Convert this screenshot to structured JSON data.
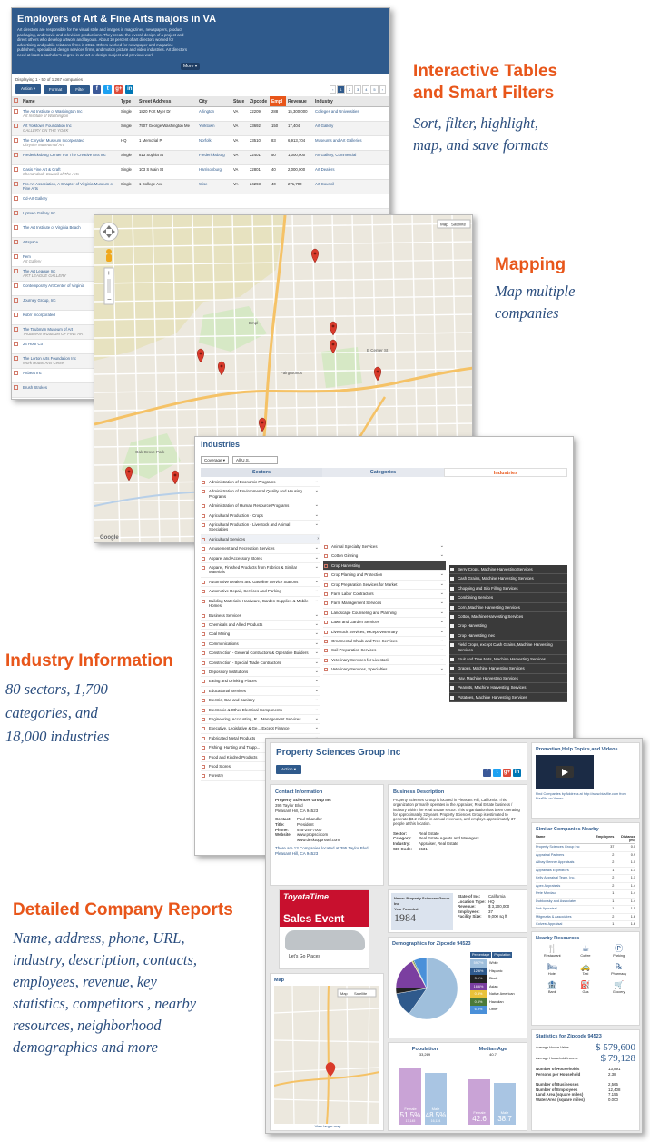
{
  "features": {
    "tables": {
      "title_line1": "Interactive Tables",
      "title_line2": "and Smart Filters",
      "desc_line1": "Sort, filter, highlight,",
      "desc_line2": "map, and save formats"
    },
    "mapping": {
      "title": "Mapping",
      "desc_line1": "Map multiple",
      "desc_line2": "companies"
    },
    "industry": {
      "title": "Industry  Information",
      "desc_line1": "80 sectors, 1,700",
      "desc_line2": "categories,  and",
      "desc_line3": "18,000 industries"
    },
    "reports": {
      "title": "Detailed Company Reports",
      "desc_line1": "Name, address, phone,  URL,",
      "desc_line2": "industry, description, contacts,",
      "desc_line3": "employees, revenue,  key",
      "desc_line4": "statistics,  competitors , nearby",
      "desc_line5": "resources, neighborhood",
      "desc_line6": "demographics and more"
    }
  },
  "table": {
    "title": "Employers of Art & Fine Arts majors in VA",
    "intro": "Art directors are responsible for the visual style and images in magazines, newspapers, product packaging, and movie and television productions. They create the overall design of a project and direct others who develop artwork and layouts. About 10 percent of art directors worked for advertising and public relations firms in 2012. Others worked for newspaper and magazine publishers, specialized design services firms, and motion picture and video industries. Art directors need at least a bachelor's degree in an art or design subject and previous work",
    "more": "More ▾",
    "displaying": "Displaying 1 - 50 of 1,267 companies",
    "buttons": {
      "action": "Action ▾",
      "format": "Format",
      "filter": "Filter"
    },
    "social": [
      "f",
      "t",
      "g+",
      "in"
    ],
    "pager": [
      "‹",
      "1",
      "2",
      "3",
      "4",
      "5",
      "›"
    ],
    "columns": [
      "Name",
      "Type",
      "Street Address",
      "City",
      "State",
      "Zipcode",
      "Empl",
      "Revenue",
      "Industry"
    ],
    "rows": [
      {
        "name": "The Art Institute of Washington Inc",
        "sub": "Art Institute of Washington",
        "type": "Single",
        "addr": "1820 Fort Myer Dr",
        "city": "Arlington",
        "state": "VA",
        "zip": "22209",
        "empl": "288",
        "rev": "15,300,000",
        "ind": "Colleges and Universities"
      },
      {
        "name": "Art Yorktown Foundation Inc",
        "sub": "GALLERY ON THE YORK",
        "type": "Single",
        "addr": "7907 George Washington Me",
        "city": "Yorktown",
        "state": "VA",
        "zip": "23692",
        "empl": "150",
        "rev": "17,404",
        "ind": "Art Gallery"
      },
      {
        "name": "The Chrysler Museum Incorporated",
        "sub": "Chrysler Museum of Art",
        "type": "HQ",
        "addr": "1 Memorial Pl",
        "city": "Norfolk",
        "state": "VA",
        "zip": "23510",
        "empl": "83",
        "rev": "6,913,704",
        "ind": "Museums and Art Galleries"
      },
      {
        "name": "Fredericksburg Center For The Creative Arts Inc",
        "sub": "",
        "type": "Single",
        "addr": "813 Sophia St",
        "city": "Fredericksburg",
        "state": "VA",
        "zip": "22401",
        "empl": "50",
        "rev": "1,000,000",
        "ind": "Art Gallery, Commercial"
      },
      {
        "name": "Oasis Fine Art & Craft",
        "sub": "Shenandoah Council of The Arts",
        "type": "Single",
        "addr": "103 S Main St",
        "city": "Harrisonburg",
        "state": "VA",
        "zip": "22801",
        "empl": "40",
        "rev": "2,000,000",
        "ind": "Art Dealers"
      },
      {
        "name": "Pro Art Association, A Chapter of Virginia Museum of Fine Arts",
        "sub": "",
        "type": "Single",
        "addr": "1 College Ave",
        "city": "Wise",
        "state": "VA",
        "zip": "24293",
        "empl": "40",
        "rev": "271,700",
        "ind": "Art Council"
      },
      {
        "name": "Cd-Art Gallery",
        "sub": ""
      },
      {
        "name": "Uptown Gallery Inc",
        "sub": ""
      },
      {
        "name": "The Art Institute of Virginia Beach",
        "sub": ""
      },
      {
        "name": "Artspace",
        "sub": ""
      },
      {
        "name": "Pem",
        "sub": "Art Gallery"
      },
      {
        "name": "The Art League Inc",
        "sub": "ART LEAGUE GALLERY"
      },
      {
        "name": "Contemporary Art Center of Virginia",
        "sub": ""
      },
      {
        "name": "Journey Group, Inc",
        "sub": ""
      },
      {
        "name": "Kobrr Incorporated",
        "sub": ""
      },
      {
        "name": "The Taubman Museum of Art",
        "sub": "TAUBMAN MUSEUM OF FINE ART"
      },
      {
        "name": "24 Hour Co",
        "sub": ""
      },
      {
        "name": "The Lorton Arts Foundation Inc",
        "sub": "Work House Arts Center"
      },
      {
        "name": "Artbeat Inc",
        "sub": ""
      },
      {
        "name": "Brush Strokes",
        "sub": ""
      }
    ]
  },
  "map": {
    "map_btn": "Map",
    "sat_btn": "Satellite",
    "labels": [
      "Empl",
      "E Center St",
      "Fairgrounds",
      "Oak Grove Park"
    ],
    "footer": "Google"
  },
  "industries": {
    "title": "Industries",
    "coverage_label": "Coverage ▾",
    "coverage_value": "All U.S.",
    "col_sectors": "Sectors",
    "col_categories": "Categories",
    "col_industries": "Industries",
    "sectors": [
      "Administration of Economic Programs",
      "Administration of Environmental Quality and Housing Programs",
      "Administration of Human Resource Programs",
      "Agricultural Production - Crops",
      "Agricultural Production - Livestock and Animal Specialties",
      "Agricultural Services",
      "Amusement and Recreation Services",
      "Apparel and Accessory Stores",
      "Apparel, Finished Products from Fabrics & Similar Materials",
      "Automotive Dealers and Gasoline Service Stations",
      "Automotive Repair, Services and Parking",
      "Building Materials, Hardware, Garden Supplies & Mobile Homes",
      "Business Services",
      "Chemicals and Allied Products",
      "Coal Mining",
      "Communications",
      "Construction - General Contractors & Operative Builders",
      "Construction - Special Trade Contractors",
      "Depository Institutions",
      "Eating and Drinking Places",
      "Educational Services",
      "Electric, Gas and Sanitary",
      "Electronic & Other Electrical Components",
      "Engineering, Accounting, R... Management Services",
      "Executive, Legislative & Ge... Except Finance",
      "Fabricated Metal Products",
      "Fishing, Hunting and Trapp...",
      "Food and Kindred Products",
      "Food Stores",
      "Forestry"
    ],
    "categories": [
      "Animal Specialty Services",
      "Cotton Ginning",
      "Crop Harvesting",
      "Crop Planting and Protection",
      "Crop Preparation Services for Market",
      "Farm Labor Contractors",
      "Farm Management Services",
      "Landscape Counseling and Planning",
      "Lawn and Garden Services",
      "Livestock Services, except Veterinary",
      "Ornamental Shrub and Tree Services",
      "Soil Preparation Services",
      "Veterinary Services for Livestock",
      "Veterinary Services, Specialties"
    ],
    "industries": [
      "Berry Crops, Machine Harvesting Services",
      "Cash Grains, Machine Harvesting Services",
      "Chopping and Silo Filling Services",
      "Combining Services",
      "Corn, Machine Harvesting Services",
      "Cotton, Machine Harvesting Services",
      "Crop Harvesting",
      "Crop Harvesting, nec",
      "Field Crops, except Cash Grains, Machine Harvesting Services",
      "Fruit and Tree Nuts, Machine Harvesting Services",
      "Grapes, Machine Harvesting Services",
      "Hay, Machine Harvesting Services",
      "Peanuts, Machine Harvesting Services",
      "Potatoes, Machine Harvesting Services"
    ]
  },
  "report": {
    "company": "Property Sciences Group Inc",
    "action": "Action ▾",
    "contact": {
      "heading": "Contact Information",
      "name": "Property Sciences Group Inc",
      "address1": "395 Taylor Blvd",
      "address2": "Pleasant Hill, CA 94523",
      "rows": [
        [
          "Contact:",
          "Paul Chandler"
        ],
        [
          "Title:",
          "President"
        ],
        [
          "Phone:",
          "925-246-7000"
        ],
        [
          "Website:",
          "www.propsci.com"
        ],
        [
          "",
          "www.desktopprssel.com"
        ]
      ],
      "note": "There are 13 Companies located at 395 Taylor Blvd, Pleasant Hill, CA 94523"
    },
    "business": {
      "heading": "Business Description",
      "text": "Property Sciences Group is located in Pleasant Hill, California. This organization primarily operates in the Appraiser, Real Estate business / industry within the Real Estate sector. This organization has been operating for approximately 32 years. Property Sciences Group is estimated to generate $3.2 million in annual revenues, and employs approximately 37 people at this location.",
      "rows": [
        [
          "Sector:",
          "Real Estate"
        ],
        [
          "Category:",
          "Real Estate Agents and Managers"
        ],
        [
          "Industry:",
          "Appraiser, Real Estate"
        ],
        [
          "SIC Code:",
          "6531"
        ]
      ]
    },
    "stats": {
      "name_label": "Name: Property Sciences Group Inc",
      "founded_label": "Year Founded:",
      "founded": "1984",
      "rows": [
        [
          "State of Inc:",
          "California"
        ],
        [
          "Location Type:",
          "HQ"
        ],
        [
          "Revenue:",
          "$ 3,200,000"
        ],
        [
          "Employees:",
          "37"
        ],
        [
          "Facility Size:",
          "9,000 sq ft"
        ]
      ]
    },
    "ad": {
      "brand": "ToyotaTime",
      "line1": "Sales Event",
      "line2": "Let's Go Places"
    },
    "demo": {
      "heading": "Demographics for Zipcode 94523",
      "col1": "Percentage",
      "col2": "Population",
      "legend": [
        [
          "59.7%",
          "White",
          "#9fbfdc"
        ],
        [
          "12.6%",
          "Hispanic",
          "#2f5a8c"
        ],
        [
          "3.1%",
          "Black",
          "#222222"
        ],
        [
          "16.6%",
          "Asian",
          "#7b3fa0"
        ],
        [
          "0.5%",
          "Native American",
          "#e8c23a"
        ],
        [
          "0.6%",
          "Hawaiian",
          "#4b7a3a"
        ],
        [
          "6.9%",
          "Other",
          "#4a90d9"
        ]
      ],
      "pie": [
        59.7,
        12.6,
        3.1,
        16.6,
        0.5,
        0.6,
        6.9
      ]
    },
    "pop": {
      "heading": "Population",
      "value": "33,269",
      "female": "51.5%",
      "male": "48.5%",
      "female_label": "Female",
      "male_label": "Male",
      "female_n": "17,145",
      "male_n": "16,124"
    },
    "age": {
      "heading": "Median Age",
      "value": "40.7",
      "female": "42.6",
      "male": "38.7",
      "female_label": "Female",
      "male_label": "Male"
    },
    "map": {
      "heading": "Map",
      "btn_map": "Map",
      "btn_sat": "Satellite",
      "link": "View larger map"
    },
    "promo": {
      "heading": "Promotion,Help Topics,and Videos",
      "caption": "Find Companies by Address at http://www.bizzflie.com from BizzFile on Vimeo."
    },
    "similar": {
      "heading": "Similar Companies Nearby",
      "cols": [
        "Name",
        "Employees",
        "Distance (mi)"
      ],
      "rows": [
        [
          "Property Sciences Group Inc",
          "37",
          "0.0"
        ],
        [
          "Appraisal Partners",
          "2",
          "0.9"
        ],
        [
          "Allbay Renner Appraisals",
          "2",
          "1.0"
        ],
        [
          "Appraisals Expeditors",
          "1",
          "1.1"
        ],
        [
          "Kelly Appraisal Team, Inc.",
          "2",
          "1.1"
        ],
        [
          "Apex Appraisals",
          "2",
          "1.4"
        ],
        [
          "Pete Mordau",
          "1",
          "1.4"
        ],
        [
          "Dubkovsky and Associates",
          "1",
          "1.4"
        ],
        [
          "Dak Appraisal",
          "1",
          "1.5"
        ],
        [
          "Mitgmatta & Associates",
          "2",
          "1.6"
        ],
        [
          "Colvest Appraisal",
          "1",
          "1.6"
        ]
      ]
    },
    "nearby": {
      "heading": "Nearby Resources",
      "items": [
        "Restaurant",
        "Coffee",
        "Parking",
        "Hotel",
        "Taxi",
        "Pharmacy",
        "Bank",
        "Gas",
        "Grocery"
      ]
    },
    "zipstats": {
      "heading": "Statistics for Zipcode 94523",
      "home_label": "Average House Value",
      "home_value": "$ 579,600",
      "income_label": "Average Household Income",
      "income_value": "$ 79,128",
      "rows": [
        [
          "Number of Households",
          "13,891"
        ],
        [
          "Persons per Household",
          "2.38"
        ]
      ],
      "rows2": [
        [
          "Number of Businesses",
          "2,565"
        ],
        [
          "Number of Employees",
          "12,408"
        ],
        [
          "Land Area (square miles)",
          "7.155"
        ],
        [
          "Water Area (square miles)",
          "0.000"
        ]
      ]
    }
  }
}
